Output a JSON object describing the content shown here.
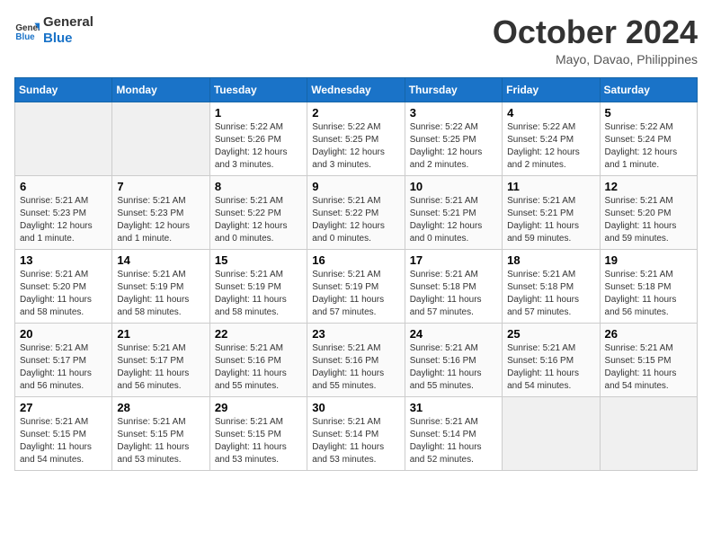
{
  "logo": {
    "line1": "General",
    "line2": "Blue"
  },
  "title": "October 2024",
  "location": "Mayo, Davao, Philippines",
  "weekdays": [
    "Sunday",
    "Monday",
    "Tuesday",
    "Wednesday",
    "Thursday",
    "Friday",
    "Saturday"
  ],
  "weeks": [
    [
      {
        "day": "",
        "content": ""
      },
      {
        "day": "",
        "content": ""
      },
      {
        "day": "1",
        "content": "Sunrise: 5:22 AM\nSunset: 5:26 PM\nDaylight: 12 hours and 3 minutes."
      },
      {
        "day": "2",
        "content": "Sunrise: 5:22 AM\nSunset: 5:25 PM\nDaylight: 12 hours and 3 minutes."
      },
      {
        "day": "3",
        "content": "Sunrise: 5:22 AM\nSunset: 5:25 PM\nDaylight: 12 hours and 2 minutes."
      },
      {
        "day": "4",
        "content": "Sunrise: 5:22 AM\nSunset: 5:24 PM\nDaylight: 12 hours and 2 minutes."
      },
      {
        "day": "5",
        "content": "Sunrise: 5:22 AM\nSunset: 5:24 PM\nDaylight: 12 hours and 1 minute."
      }
    ],
    [
      {
        "day": "6",
        "content": "Sunrise: 5:21 AM\nSunset: 5:23 PM\nDaylight: 12 hours and 1 minute."
      },
      {
        "day": "7",
        "content": "Sunrise: 5:21 AM\nSunset: 5:23 PM\nDaylight: 12 hours and 1 minute."
      },
      {
        "day": "8",
        "content": "Sunrise: 5:21 AM\nSunset: 5:22 PM\nDaylight: 12 hours and 0 minutes."
      },
      {
        "day": "9",
        "content": "Sunrise: 5:21 AM\nSunset: 5:22 PM\nDaylight: 12 hours and 0 minutes."
      },
      {
        "day": "10",
        "content": "Sunrise: 5:21 AM\nSunset: 5:21 PM\nDaylight: 12 hours and 0 minutes."
      },
      {
        "day": "11",
        "content": "Sunrise: 5:21 AM\nSunset: 5:21 PM\nDaylight: 11 hours and 59 minutes."
      },
      {
        "day": "12",
        "content": "Sunrise: 5:21 AM\nSunset: 5:20 PM\nDaylight: 11 hours and 59 minutes."
      }
    ],
    [
      {
        "day": "13",
        "content": "Sunrise: 5:21 AM\nSunset: 5:20 PM\nDaylight: 11 hours and 58 minutes."
      },
      {
        "day": "14",
        "content": "Sunrise: 5:21 AM\nSunset: 5:19 PM\nDaylight: 11 hours and 58 minutes."
      },
      {
        "day": "15",
        "content": "Sunrise: 5:21 AM\nSunset: 5:19 PM\nDaylight: 11 hours and 58 minutes."
      },
      {
        "day": "16",
        "content": "Sunrise: 5:21 AM\nSunset: 5:19 PM\nDaylight: 11 hours and 57 minutes."
      },
      {
        "day": "17",
        "content": "Sunrise: 5:21 AM\nSunset: 5:18 PM\nDaylight: 11 hours and 57 minutes."
      },
      {
        "day": "18",
        "content": "Sunrise: 5:21 AM\nSunset: 5:18 PM\nDaylight: 11 hours and 57 minutes."
      },
      {
        "day": "19",
        "content": "Sunrise: 5:21 AM\nSunset: 5:18 PM\nDaylight: 11 hours and 56 minutes."
      }
    ],
    [
      {
        "day": "20",
        "content": "Sunrise: 5:21 AM\nSunset: 5:17 PM\nDaylight: 11 hours and 56 minutes."
      },
      {
        "day": "21",
        "content": "Sunrise: 5:21 AM\nSunset: 5:17 PM\nDaylight: 11 hours and 56 minutes."
      },
      {
        "day": "22",
        "content": "Sunrise: 5:21 AM\nSunset: 5:16 PM\nDaylight: 11 hours and 55 minutes."
      },
      {
        "day": "23",
        "content": "Sunrise: 5:21 AM\nSunset: 5:16 PM\nDaylight: 11 hours and 55 minutes."
      },
      {
        "day": "24",
        "content": "Sunrise: 5:21 AM\nSunset: 5:16 PM\nDaylight: 11 hours and 55 minutes."
      },
      {
        "day": "25",
        "content": "Sunrise: 5:21 AM\nSunset: 5:16 PM\nDaylight: 11 hours and 54 minutes."
      },
      {
        "day": "26",
        "content": "Sunrise: 5:21 AM\nSunset: 5:15 PM\nDaylight: 11 hours and 54 minutes."
      }
    ],
    [
      {
        "day": "27",
        "content": "Sunrise: 5:21 AM\nSunset: 5:15 PM\nDaylight: 11 hours and 54 minutes."
      },
      {
        "day": "28",
        "content": "Sunrise: 5:21 AM\nSunset: 5:15 PM\nDaylight: 11 hours and 53 minutes."
      },
      {
        "day": "29",
        "content": "Sunrise: 5:21 AM\nSunset: 5:15 PM\nDaylight: 11 hours and 53 minutes."
      },
      {
        "day": "30",
        "content": "Sunrise: 5:21 AM\nSunset: 5:14 PM\nDaylight: 11 hours and 53 minutes."
      },
      {
        "day": "31",
        "content": "Sunrise: 5:21 AM\nSunset: 5:14 PM\nDaylight: 11 hours and 52 minutes."
      },
      {
        "day": "",
        "content": ""
      },
      {
        "day": "",
        "content": ""
      }
    ]
  ]
}
